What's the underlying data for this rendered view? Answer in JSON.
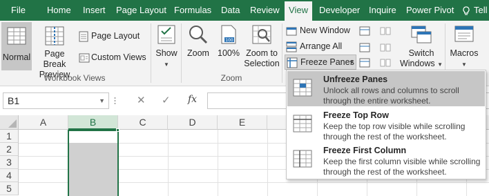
{
  "tabs": [
    {
      "label": "File",
      "active": false
    },
    {
      "label": "Home",
      "active": false
    },
    {
      "label": "Insert",
      "active": false
    },
    {
      "label": "Page Layout",
      "active": false
    },
    {
      "label": "Formulas",
      "active": false
    },
    {
      "label": "Data",
      "active": false
    },
    {
      "label": "Review",
      "active": false
    },
    {
      "label": "View",
      "active": true
    },
    {
      "label": "Developer",
      "active": false
    },
    {
      "label": "Inquire",
      "active": false
    },
    {
      "label": "Power Pivot",
      "active": false
    }
  ],
  "tell_me": {
    "label": "Tell",
    "icon": "lightbulb-icon"
  },
  "ribbon": {
    "workbook_views": {
      "group_label": "Workbook Views",
      "normal": "Normal",
      "page_break_1": "Page Break",
      "page_break_2": "Preview",
      "page_layout": "Page Layout",
      "custom_views": "Custom Views"
    },
    "show": {
      "label": "Show"
    },
    "zoom": {
      "group_label": "Zoom",
      "zoom": "Zoom",
      "zoom100": "100%",
      "zoom_sel_1": "Zoom to",
      "zoom_sel_2": "Selection"
    },
    "window": {
      "new_window": "New Window",
      "arrange_all": "Arrange All",
      "freeze_panes": "Freeze Panes",
      "switch_1": "Switch",
      "switch_2": "Windows"
    },
    "macros": {
      "label": "Macros"
    }
  },
  "formula_bar": {
    "name_box": "B1",
    "fx": "fx",
    "value": ""
  },
  "grid": {
    "columns": [
      "A",
      "B",
      "C",
      "D",
      "E"
    ],
    "rows": [
      "1",
      "2",
      "3",
      "4",
      "5"
    ],
    "selected_column": "B"
  },
  "freeze_menu": {
    "items": [
      {
        "title": "Unfreeze Panes",
        "desc": "Unlock all rows and columns to scroll through the entire worksheet.",
        "highlighted": true
      },
      {
        "title": "Freeze Top Row",
        "desc": "Keep the top row visible while scrolling through the rest of the worksheet.",
        "highlighted": false
      },
      {
        "title": "Freeze First Column",
        "desc": "Keep the first column visible while scrolling through the rest of the worksheet.",
        "highlighted": false
      }
    ]
  },
  "colors": {
    "accent": "#217346",
    "ribbon_bg": "#f3f3f3",
    "menu_highlight": "#c6c6c6"
  }
}
